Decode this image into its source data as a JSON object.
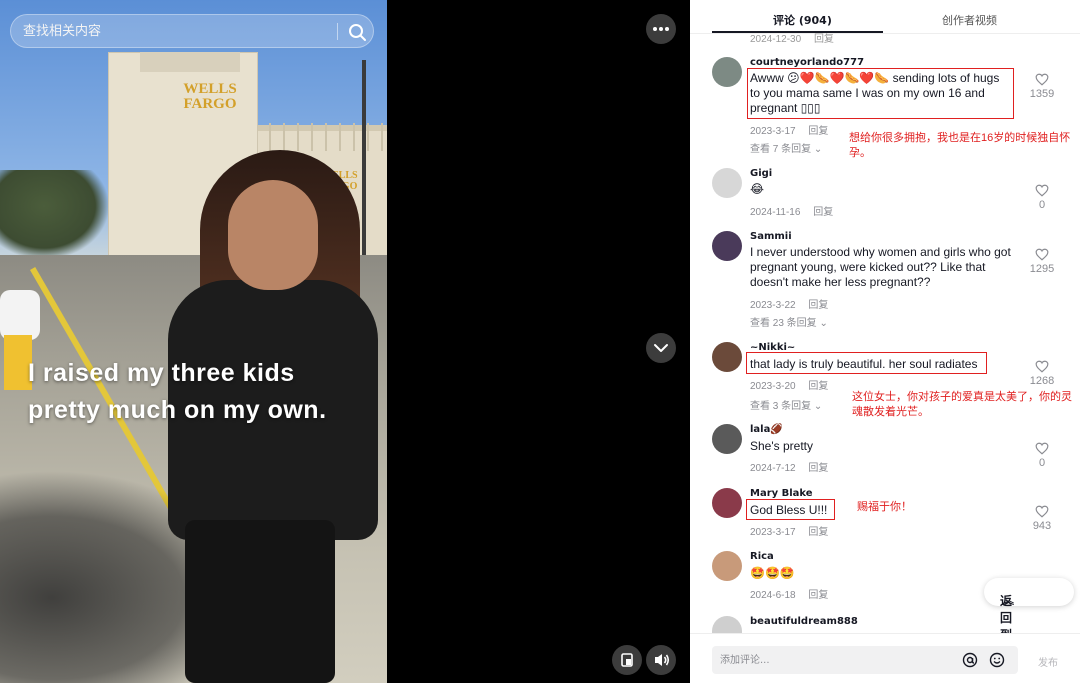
{
  "search": {
    "placeholder": "查找相关内容"
  },
  "video": {
    "caption_lines": [
      "I raised my three kids",
      "pretty much on my own."
    ],
    "store_sign": "WELLS FARGO",
    "store_sign_side": "WELLS FARGO"
  },
  "tabs": [
    {
      "label": "评论 (904)",
      "active": true
    },
    {
      "label": "创作者视频",
      "active": false
    }
  ],
  "clipped_meta": {
    "date": "2024-12-30",
    "reply": "回复"
  },
  "comments": [
    {
      "user": "courtneyorlando777",
      "text": "Awww 😕❤️🌭❤️🌭❤️🌭 sending lots of hugs to you mama same I was on my own 16 and pregnant ▯▯▯",
      "date": "2023-3-17",
      "reply": "回复",
      "more": "查看 7 条回复",
      "likes": "1359",
      "note": "想给你很多拥抱，我也是在16岁的时候独自怀孕。",
      "avatar_color": "#7d8a84"
    },
    {
      "user": "Gigi",
      "text": "😂",
      "date": "2024-11-16",
      "reply": "回复",
      "more": "",
      "likes": "0",
      "note": "",
      "avatar_color": "#d7d7d7"
    },
    {
      "user": "Sammii",
      "text": "I never understood why women and girls who got pregnant young, were kicked out?? Like that doesn't make her less pregnant??",
      "date": "2023-3-22",
      "reply": "回复",
      "more": "查看 23 条回复",
      "likes": "1295",
      "note": "",
      "avatar_color": "#4a3a5a"
    },
    {
      "user": "~Nikki~",
      "text": "that lady is truly beautiful. her soul radiates",
      "date": "2023-3-20",
      "reply": "回复",
      "more": "查看 3 条回复",
      "likes": "1268",
      "note": "这位女士，你对孩子的爱真是太美了，你的灵魂散发着光芒。",
      "avatar_color": "#6b4a3a"
    },
    {
      "user": "lala🏈",
      "text": "She's pretty",
      "date": "2024-7-12",
      "reply": "回复",
      "more": "",
      "likes": "0",
      "note": "",
      "avatar_color": "#5a5a5a"
    },
    {
      "user": "Mary Blake",
      "text": "God Bless U!!!",
      "date": "2023-3-17",
      "reply": "回复",
      "more": "",
      "likes": "943",
      "note": "赐福于你！",
      "avatar_color": "#8a3a4a"
    },
    {
      "user": "Rica",
      "text": "🤩🤩🤩",
      "date": "2024-6-18",
      "reply": "回复",
      "more": "",
      "likes": "",
      "note": "",
      "avatar_color": "#c89a7a"
    },
    {
      "user": "beautifuldream888",
      "text": "",
      "date": "",
      "reply": "",
      "more": "",
      "likes": "",
      "note": "",
      "avatar_color": "#cfcfcf"
    }
  ],
  "back_to_top": "返回到顶部",
  "comment_input": {
    "placeholder": "添加评论...",
    "send_label": "发布"
  },
  "colors": {
    "annotation_red": "#e02020",
    "text_dark": "#161823",
    "meta_gray": "#8a8b91"
  }
}
